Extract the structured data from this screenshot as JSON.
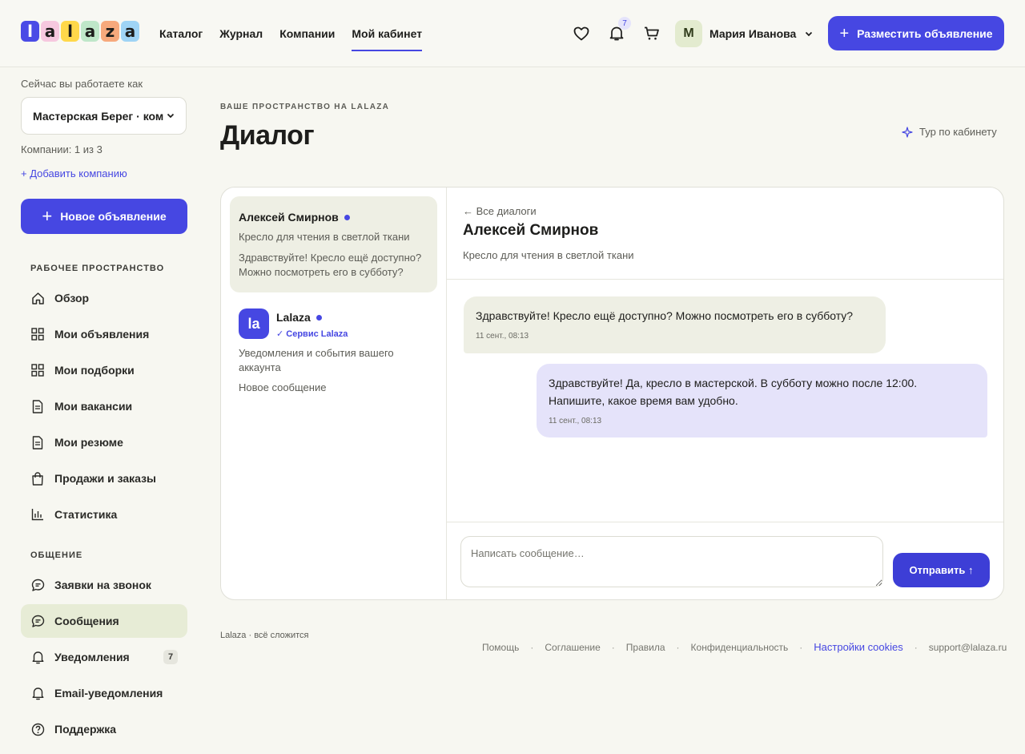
{
  "colors": {
    "accent": "#4647e2",
    "bg": "#f7f7f1",
    "active_menu": "#e7ecd6",
    "bubble_in": "#eeefe4",
    "bubble_out": "#e5e3fa"
  },
  "header": {
    "logo_letters": [
      "l",
      "a",
      "l",
      "a",
      "z",
      "a"
    ],
    "nav": [
      "Каталог",
      "Журнал",
      "Компании",
      "Мой кабинет"
    ],
    "notifications_count": "7",
    "user_initial": "М",
    "user_name": "Мария Иванова",
    "post_button": "Разместить объявление"
  },
  "sidebar": {
    "working_as": "Сейчас вы работаете как",
    "company": "Мастерская Берег · ком",
    "company_count": "Компании: 1 из 3",
    "add_company": "+ Добавить компанию",
    "new_ad": "Новое объявление",
    "workspace_title": "РАБОЧЕЕ ПРОСТРАНСТВО",
    "workspace_items": [
      {
        "label": "Обзор",
        "icon": "home-icon"
      },
      {
        "label": "Мои объявления",
        "icon": "grid-icon"
      },
      {
        "label": "Мои подборки",
        "icon": "grid-icon"
      },
      {
        "label": "Мои вакансии",
        "icon": "document-icon"
      },
      {
        "label": "Мои резюме",
        "icon": "document-icon"
      },
      {
        "label": "Продажи и заказы",
        "icon": "bag-icon"
      },
      {
        "label": "Статистика",
        "icon": "chart-icon"
      }
    ],
    "communication_title": "ОБЩЕНИЕ",
    "communication_items": [
      {
        "label": "Заявки на звонок",
        "icon": "chat-icon"
      },
      {
        "label": "Сообщения",
        "icon": "chat-icon"
      },
      {
        "label": "Уведомления",
        "icon": "bell-icon",
        "badge": "7"
      },
      {
        "label": "Email-уведомления",
        "icon": "bell-icon"
      },
      {
        "label": "Поддержка",
        "icon": "help-icon"
      }
    ]
  },
  "main": {
    "eyebrow": "ВАШЕ ПРОСТРАНСТВО НА LALAZA",
    "title": "Диалог",
    "tour": "Тур по кабинету"
  },
  "dialogs": [
    {
      "name": "Алексей Смирнов",
      "subtitle": "Кресло для чтения в светлой ткани",
      "preview": "Здравствуйте! Кресло ещё доступно? Можно посмотреть его в субботу?"
    },
    {
      "avatar": "la",
      "name": "Lalaza",
      "tag": "✓ Сервис Lalaza",
      "subtitle": "Уведомления и события вашего аккаунта",
      "preview": "Новое сообщение"
    }
  ],
  "conversation": {
    "back": "← Все диалоги",
    "name": "Алексей Смирнов",
    "subtitle": "Кресло для чтения в светлой ткани",
    "messages": [
      {
        "text": "Здравствуйте! Кресло ещё доступно? Можно посмотреть его в субботу?",
        "time": "11 сент., 08:13"
      },
      {
        "text": "Здравствуйте! Да, кресло в мастерской. В субботу можно после 12:00. Напишите, какое время вам удобно.",
        "time": "11 сент., 08:13"
      }
    ],
    "placeholder": "Написать сообщение…",
    "send": "Отправить ↑"
  },
  "footer": {
    "brand": "Lalaza · всё сложится",
    "links": [
      "Помощь",
      "Соглашение",
      "Правила",
      "Конфиденциальность",
      "Настройки cookies",
      "support@lalaza.ru"
    ]
  }
}
